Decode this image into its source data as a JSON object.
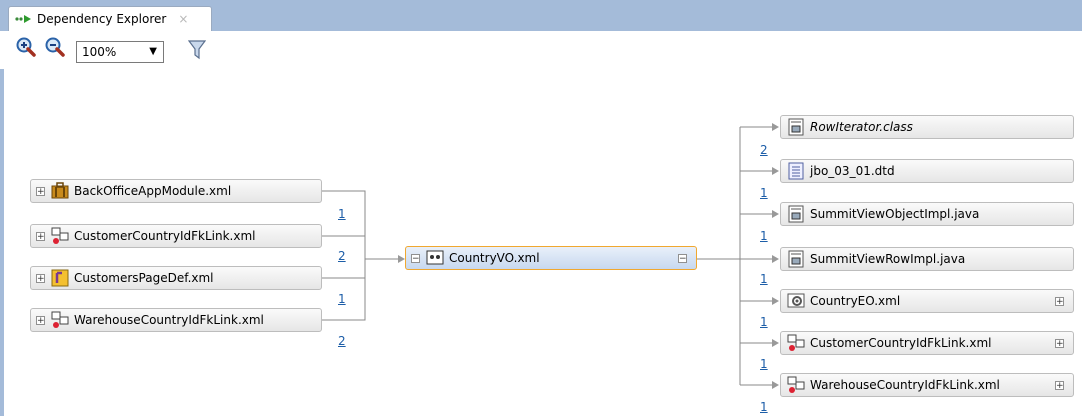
{
  "tab": {
    "title": "Dependency Explorer",
    "close": "×"
  },
  "toolbar": {
    "zoom_value": "100%",
    "zoom_arrow": "▼"
  },
  "left_nodes": [
    {
      "label": "BackOfficeAppModule.xml",
      "icon": "app-module-icon"
    },
    {
      "label": "CustomerCountryIdFkLink.xml",
      "icon": "view-link-icon"
    },
    {
      "label": "CustomersPageDef.xml",
      "icon": "page-def-icon"
    },
    {
      "label": "WarehouseCountryIdFkLink.xml",
      "icon": "view-link-icon"
    }
  ],
  "left_counts": [
    "1",
    "2",
    "1",
    "2"
  ],
  "center_node": {
    "label": "CountryVO.xml",
    "icon": "view-object-icon"
  },
  "right_nodes": [
    {
      "label": "RowIterator.class",
      "icon": "class-file-icon"
    },
    {
      "label": "jbo_03_01.dtd",
      "icon": "dtd-file-icon"
    },
    {
      "label": "SummitViewObjectImpl.java",
      "icon": "java-file-icon"
    },
    {
      "label": "SummitViewRowImpl.java",
      "icon": "java-file-icon"
    },
    {
      "label": "CountryEO.xml",
      "icon": "entity-object-icon"
    },
    {
      "label": "CustomerCountryIdFkLink.xml",
      "icon": "view-link-icon"
    },
    {
      "label": "WarehouseCountryIdFkLink.xml",
      "icon": "view-link-icon"
    }
  ],
  "right_counts": [
    "2",
    "1",
    "1",
    "1",
    "1",
    "1",
    "1"
  ],
  "expand_glyph": "+",
  "collapse_glyph": "−"
}
